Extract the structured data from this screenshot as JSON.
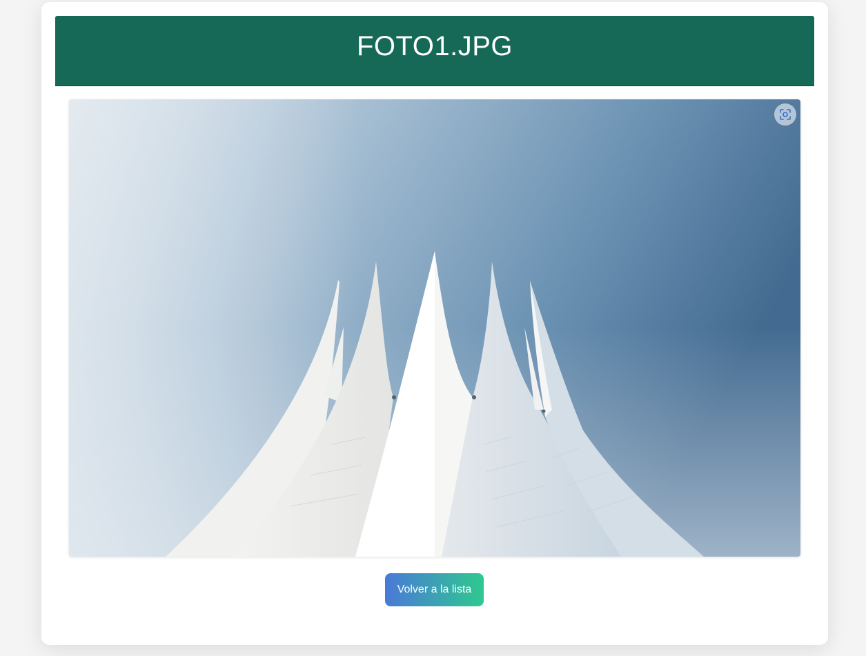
{
  "header": {
    "title": "FOTO1.JPG"
  },
  "photo": {
    "description_icon": "visual-search-icon"
  },
  "actions": {
    "back_label": "Volver a la lista"
  },
  "colors": {
    "header_bg": "#166956",
    "button_gradient_start": "#4a79d8",
    "button_gradient_end": "#2ec98f",
    "card_bg": "#ffffff",
    "page_bg": "#f4f4f4"
  }
}
